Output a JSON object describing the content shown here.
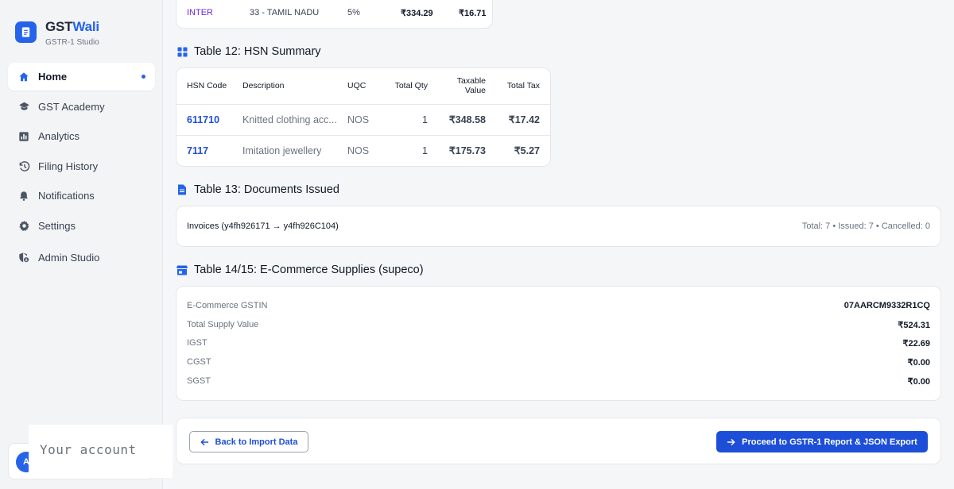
{
  "brand": {
    "name_part1": "GST",
    "name_part2": "Wali",
    "subtitle": "GSTR-1 Studio"
  },
  "sidebar": {
    "items": [
      {
        "label": "Home",
        "icon": "home-icon",
        "active": true
      },
      {
        "label": "GST Academy",
        "icon": "graduation-cap-icon"
      },
      {
        "label": "Analytics",
        "icon": "analytics-icon"
      },
      {
        "label": "Filing History",
        "icon": "history-icon"
      },
      {
        "label": "Notifications",
        "icon": "bell-icon"
      },
      {
        "label": "Settings",
        "icon": "gear-icon"
      },
      {
        "label": "Admin Studio",
        "icon": "admin-shield-icon"
      }
    ],
    "account": {
      "avatar_letter": "A",
      "popup_label": "Your account"
    }
  },
  "top_row": {
    "type": "INTER",
    "place": "33 - TAMIL NADU",
    "rate": "5%",
    "taxable": "₹334.29",
    "tax": "₹16.71"
  },
  "hsn_section": {
    "title": "Table 12: HSN Summary",
    "headers": [
      "HSN Code",
      "Description",
      "UQC",
      "Total Qty",
      "Taxable Value",
      "Total Tax"
    ],
    "rows": [
      {
        "code": "611710",
        "description": "Knitted clothing acc...",
        "uqc": "NOS",
        "qty": "1",
        "taxable": "₹348.58",
        "tax": "₹17.42"
      },
      {
        "code": "7117",
        "description": "Imitation jewellery",
        "uqc": "NOS",
        "qty": "1",
        "taxable": "₹175.73",
        "tax": "₹5.27"
      }
    ]
  },
  "docs_section": {
    "title": "Table 13: Documents Issued",
    "label": "Invoices (y4fh926171 → y4fh926C104)",
    "summary": "Total: 7 • Issued: 7 • Cancelled: 0"
  },
  "ecom_section": {
    "title": "Table 14/15: E-Commerce Supplies (supeco)",
    "rows": [
      {
        "label": "E-Commerce GSTIN",
        "value": "07AARCM9332R1CQ"
      },
      {
        "label": "Total Supply Value",
        "value": "₹524.31"
      },
      {
        "label": "IGST",
        "value": "₹22.69"
      },
      {
        "label": "CGST",
        "value": "₹0.00"
      },
      {
        "label": "SGST",
        "value": "₹0.00"
      }
    ]
  },
  "actions": {
    "back_label": "Back to Import Data",
    "proceed_label": "Proceed to GSTR-1 Report & JSON Export"
  },
  "colors": {
    "accent": "#1d4ed8",
    "brand_blue": "#2563eb"
  }
}
